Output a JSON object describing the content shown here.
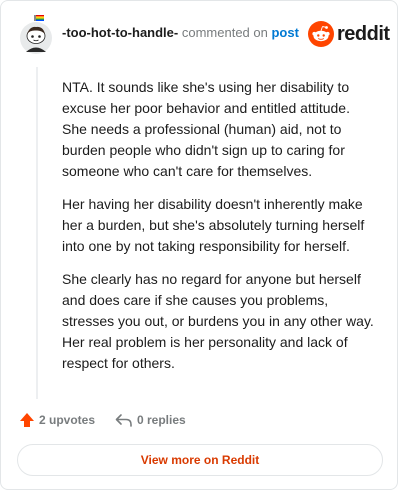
{
  "header": {
    "username": "-too-hot-to-handle-",
    "action_text": "commented on",
    "post_link": "post",
    "brand": "reddit"
  },
  "comment": {
    "paragraphs": [
      "NTA. It sounds like she's using her disability to excuse her poor behavior and entitled attitude. She needs a professional (human) aid, not to burden people who didn't sign up to caring for someone who can't care for themselves.",
      "Her having her disability doesn't inherently make her a burden, but she's absolutely turning herself into one by not taking responsibility for herself.",
      "She clearly has no regard for anyone but herself and does care if she causes you problems, stresses you out, or burdens you in any other way. Her real problem is her personality and lack of respect for others."
    ]
  },
  "actions": {
    "upvotes": "2 upvotes",
    "replies": "0 replies"
  },
  "footer": {
    "view_more": "View more on Reddit"
  },
  "colors": {
    "accent": "#d93a00",
    "upvote": "#ff4500",
    "link": "#0079d3",
    "muted": "#787c7e"
  },
  "icons": {
    "avatar": "snoo-avatar-icon",
    "brand": "reddit-logo-icon",
    "upvote": "upvote-arrow-icon",
    "reply": "reply-arrow-icon"
  }
}
